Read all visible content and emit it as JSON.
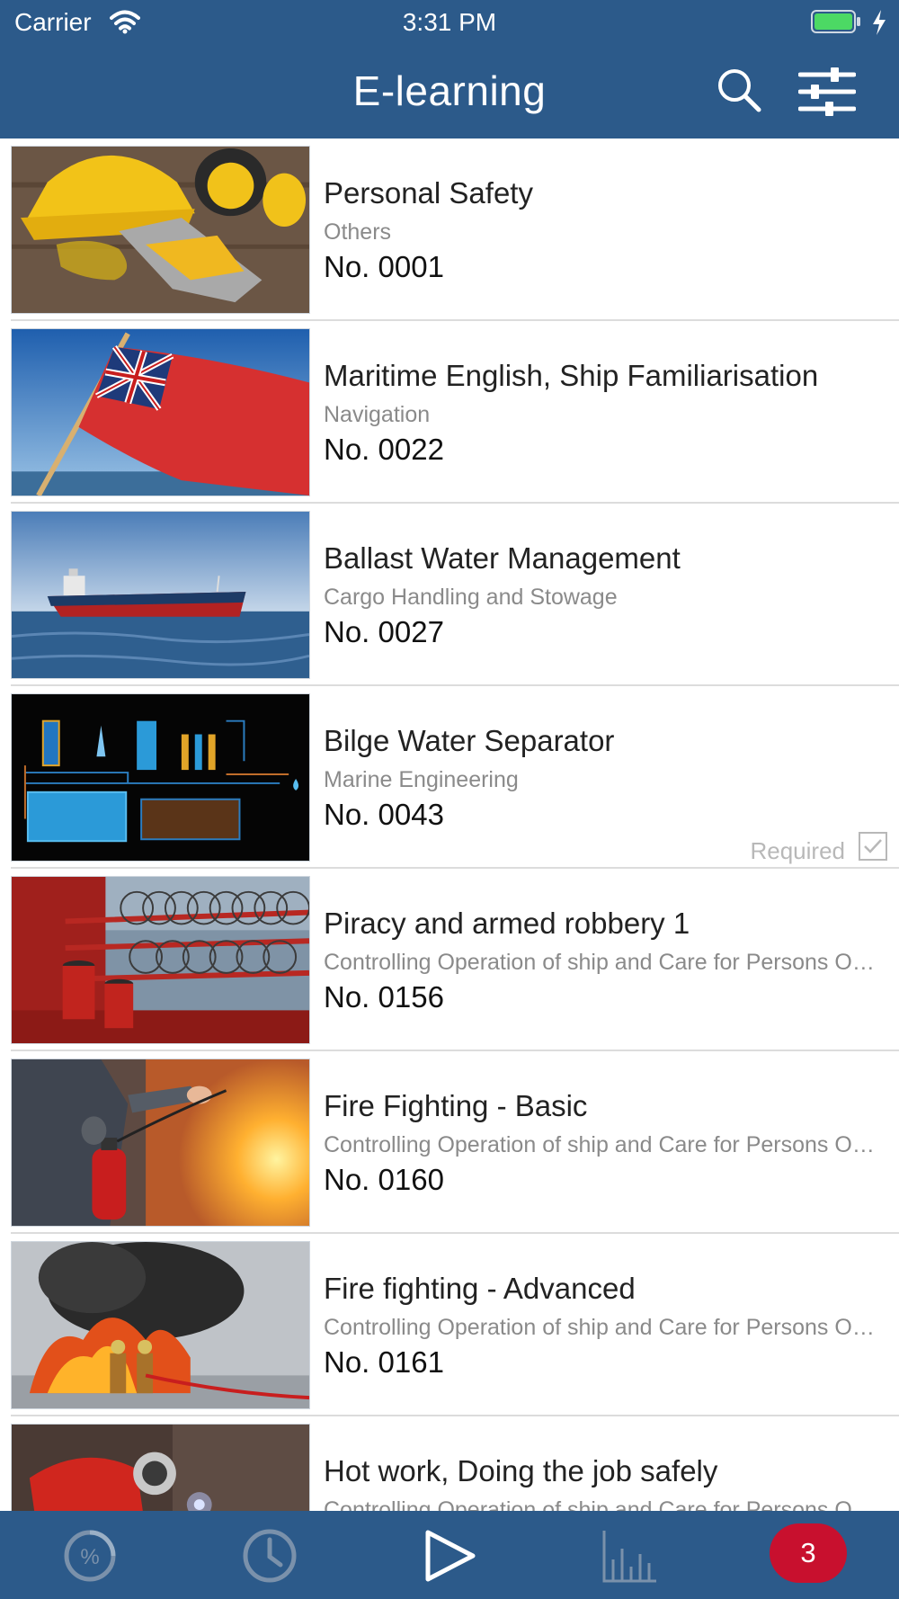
{
  "status_bar": {
    "carrier": "Carrier",
    "time": "3:31 PM"
  },
  "header": {
    "title": "E-learning"
  },
  "courses": [
    {
      "title": "Personal Safety",
      "category": "Others",
      "number": "No. 0001",
      "image": "safety-gear-image"
    },
    {
      "title": "Maritime English, Ship Familiarisation",
      "category": "Navigation",
      "number": "No. 0022",
      "image": "red-ensign-flag-image"
    },
    {
      "title": "Ballast Water Management",
      "category": "Cargo Handling and Stowage",
      "number": "No. 0027",
      "image": "cargo-ship-image"
    },
    {
      "title": "Bilge Water Separator",
      "category": "Marine Engineering",
      "number": "No. 0043",
      "image": "separator-schematic-image",
      "required_label": "Required",
      "required": true
    },
    {
      "title": "Piracy and armed robbery 1",
      "category": "Controlling Operation of ship and Care for Persons On Board",
      "number": "No. 0156",
      "image": "razor-wire-deck-image"
    },
    {
      "title": "Fire Fighting - Basic",
      "category": "Controlling Operation of ship and Care for Persons On Board",
      "number": "No. 0160",
      "image": "fire-extinguisher-image"
    },
    {
      "title": "Fire fighting - Advanced",
      "category": "Controlling Operation of ship and Care for Persons On Board",
      "number": "No. 0161",
      "image": "firefighters-image"
    },
    {
      "title": "Hot work, Doing the job safely",
      "category": "Controlling Operation of ship and Care for Persons On Board",
      "number": "",
      "image": "welding-image"
    }
  ],
  "tab_bar": {
    "tabs": [
      "progress-percent-icon",
      "history-clock-icon",
      "play-icon",
      "statistics-chart-icon"
    ],
    "badge_count": "3"
  },
  "colors": {
    "brand": "#2c5a8a",
    "badge": "#c8102e"
  }
}
